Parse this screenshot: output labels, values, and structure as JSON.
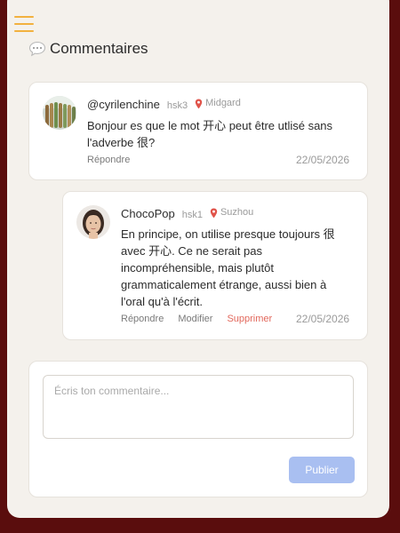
{
  "section": {
    "title": "Commentaires",
    "icon": "speech-bubble-icon"
  },
  "comments": [
    {
      "username": "@cyrilenchine",
      "level": "hsk3",
      "location": "Midgard",
      "text": "Bonjour es que le mot 开心 peut être utlisé sans l'adverbe 很?",
      "actions": [
        "Répondre"
      ],
      "date": "22/05/2026"
    },
    {
      "username": "ChocoPop",
      "level": "hsk1",
      "location": "Suzhou",
      "text": "En principe, on utilise presque toujours 很 avec 开心. Ce ne serait pas incompréhensible, mais plutôt grammaticalement étrange, aussi bien à l'oral qu'à l'écrit.",
      "actions": [
        "Répondre",
        "Modifier",
        "Supprimer"
      ],
      "date": "22/05/2026"
    }
  ],
  "composer": {
    "placeholder": "Écris ton commentaire...",
    "value": "",
    "submit_label": "Publier"
  },
  "colors": {
    "menu_accent": "#f2b13f",
    "publish_button": "#a9bff1",
    "delete_action": "#e2685c",
    "pin": "#e0534a",
    "background": "#5a0d0d"
  }
}
